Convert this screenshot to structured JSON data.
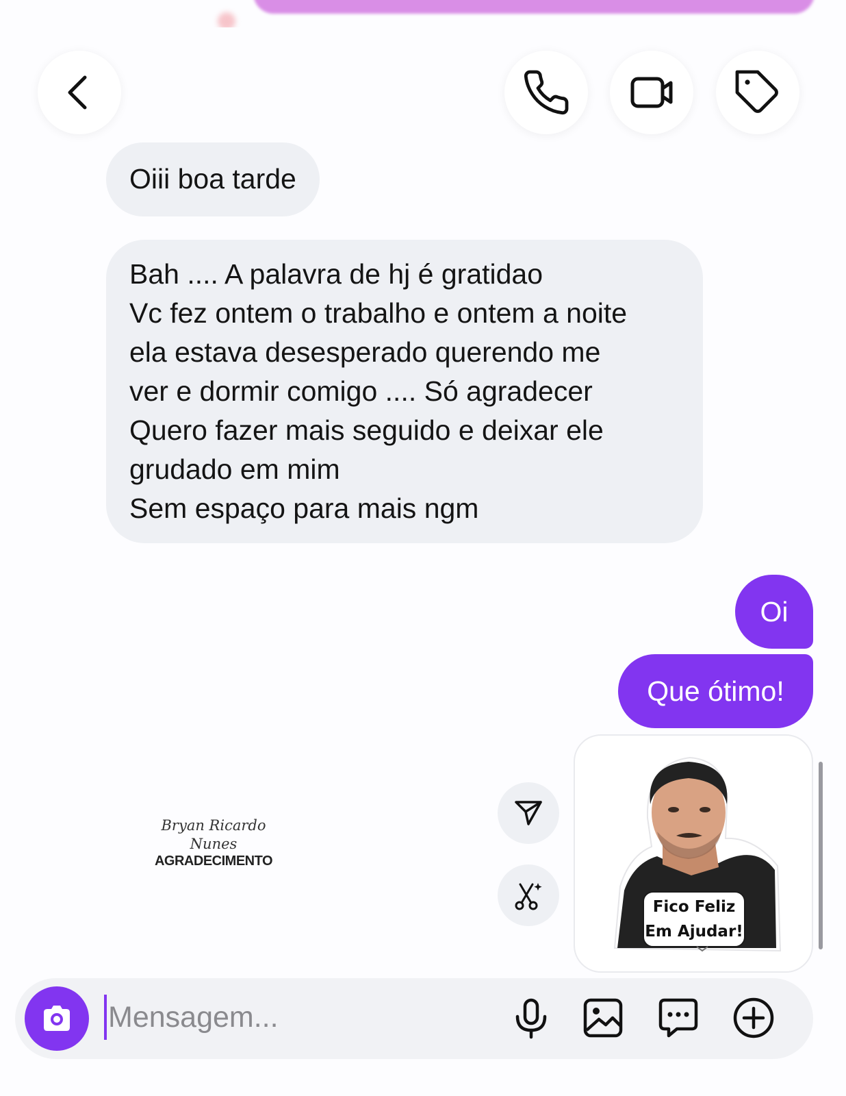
{
  "header": {
    "back_icon": "chevron-left-icon",
    "actions": [
      "phone-icon",
      "video-camera-icon",
      "tag-icon"
    ]
  },
  "messages": [
    {
      "direction": "incoming",
      "lines": [
        "Oiii boa tarde"
      ]
    },
    {
      "direction": "incoming",
      "lines": [
        "Bah .... A palavra de hj é gratidao",
        "Vc fez ontem o trabalho e ontem a noite",
        "ela estava desesperado querendo me",
        "ver e dormir comigo .... Só agradecer",
        "Quero fazer mais seguido e deixar ele",
        "grudado em mim",
        "Sem espaço para mais ngm"
      ]
    },
    {
      "direction": "outgoing",
      "lines": [
        "Oi"
      ]
    },
    {
      "direction": "outgoing",
      "lines": [
        "Que ótimo!"
      ]
    }
  ],
  "sticker": {
    "caption_line1": "Fico Feliz",
    "caption_line2": "Em Ajudar!"
  },
  "watermark": {
    "script_line1": "Bryan Ricardo",
    "script_line2": "Nunes",
    "bold": "AGRADECIMENTO"
  },
  "side_actions": [
    "send-icon",
    "magic-cut-icon"
  ],
  "composer": {
    "placeholder": "Mensagem...",
    "tools": [
      "microphone-icon",
      "gallery-icon",
      "chat-dots-icon",
      "plus-circle-icon"
    ]
  },
  "colors": {
    "accent": "#8235f0",
    "incoming_bubble": "#eef0f4",
    "background": "#fdfdff"
  }
}
